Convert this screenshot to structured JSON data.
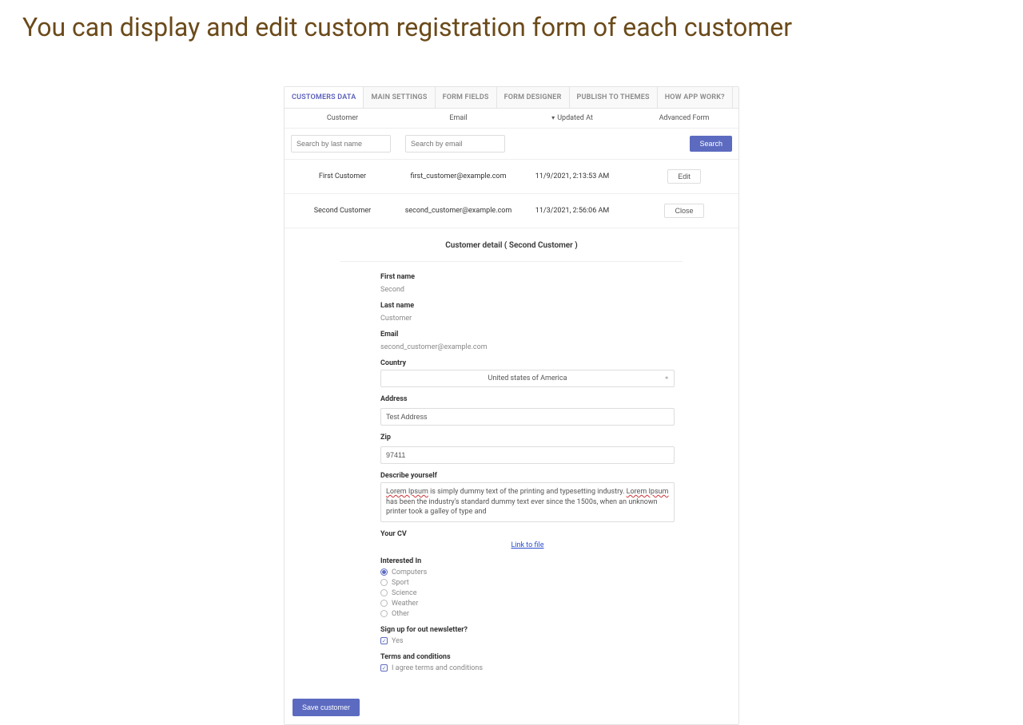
{
  "page_title": "You can display and edit custom registration form of each customer",
  "tabs": {
    "customers_data": "CUSTOMERS DATA",
    "main_settings": "MAIN SETTINGS",
    "form_fields": "FORM FIELDS",
    "form_designer": "FORM DESIGNER",
    "publish_to_themes": "PUBLISH TO THEMES",
    "how_app_work": "HOW APP WORK?"
  },
  "columns": {
    "customer": "Customer",
    "email": "Email",
    "updated_at": "Updated At",
    "advanced_form": "Advanced Form"
  },
  "filters": {
    "lastname_placeholder": "Search by last name",
    "email_placeholder": "Search by email",
    "search_button": "Search"
  },
  "rows": [
    {
      "customer": "First Customer",
      "email": "first_customer@example.com",
      "updated": "11/9/2021, 2:13:53 AM",
      "action": "Edit"
    },
    {
      "customer": "Second Customer",
      "email": "second_customer@example.com",
      "updated": "11/3/2021, 2:56:06 AM",
      "action": "Close"
    }
  ],
  "detail": {
    "title": "Customer detail ( Second Customer )",
    "first_name_label": "First name",
    "first_name_value": "Second",
    "last_name_label": "Last name",
    "last_name_value": "Customer",
    "email_label": "Email",
    "email_value": "second_customer@example.com",
    "country_label": "Country",
    "country_value": "United states of America",
    "address_label": "Address",
    "address_value": "Test Address",
    "zip_label": "Zip",
    "zip_value": "97411",
    "describe_label": "Describe yourself",
    "describe_p1a": "Lorem Ipsum",
    "describe_p1b": " is simply dummy text of the printing and typesetting industry. ",
    "describe_p1c": "Lorem Ipsum",
    "describe_p1d": " has been the industry's standard dummy text ever since the 1500s, when an unknown printer took a galley of type and",
    "cv_label": "Your CV",
    "cv_link": "Link to file",
    "interested_label": "Interested In",
    "interests": {
      "computers": "Computers",
      "sport": "Sport",
      "science": "Science",
      "weather": "Weather",
      "other": "Other"
    },
    "newsletter_label": "Sign up for out newsletter?",
    "newsletter_yes": "Yes",
    "terms_label": "Terms and conditions",
    "terms_text": "I agree terms and conditions",
    "save_button": "Save customer"
  }
}
